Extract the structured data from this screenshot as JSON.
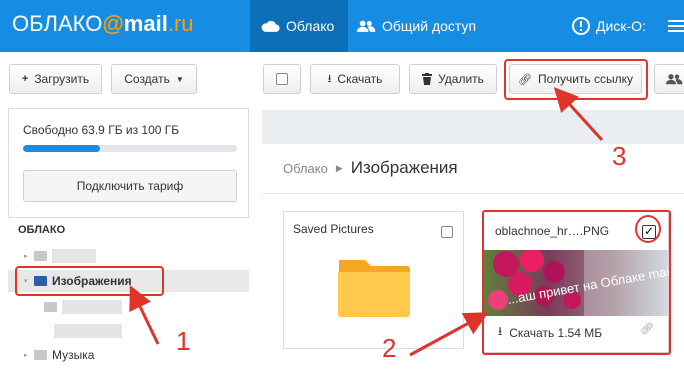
{
  "header": {
    "logo_prefix": "ОБЛАКО",
    "logo_at": "@",
    "logo_mail": "mail",
    "logo_ru": ".ru",
    "nav_cloud": "Облако",
    "nav_shared": "Общий доступ",
    "nav_disk": "Диск-О:"
  },
  "toolbar": {
    "upload": "Загрузить",
    "create": "Создать",
    "download": "Скачать",
    "delete": "Удалить",
    "get_link": "Получить ссылку"
  },
  "storage": {
    "text": "Свободно 63.9 ГБ из 100 ГБ",
    "used_fraction": 0.361,
    "tariff_button": "Подключить тариф"
  },
  "tree": {
    "heading": "ОБЛАКО",
    "selected_folder": "Изображения",
    "last_folder": "Музыка"
  },
  "breadcrumb": {
    "root": "Облако",
    "current": "Изображения"
  },
  "files": [
    {
      "name": "Saved Pictures",
      "type": "folder"
    },
    {
      "name": "oblachnoe_hr….PNG",
      "type": "image",
      "overlay_text": "...аш привет на Облаке mail.ru!",
      "download_label": "Скачать 1.54 МБ"
    }
  ],
  "annotations": [
    "1",
    "2",
    "3"
  ],
  "colors": {
    "header": "#168de2",
    "header_active": "#0d6fb8",
    "accent": "#ff9e00",
    "highlight": "#e0332b",
    "folder": "#ffc94d"
  }
}
